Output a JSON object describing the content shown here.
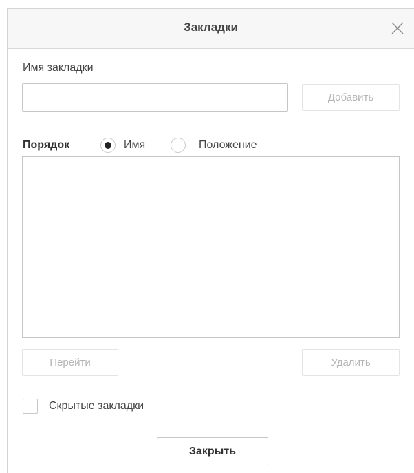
{
  "dialog": {
    "title": "Закладки",
    "close_icon": "close-icon",
    "name_label": "Имя закладки",
    "name_input": {
      "value": "",
      "placeholder": ""
    },
    "add_button": "Добавить",
    "sort": {
      "label": "Порядок",
      "options": [
        {
          "label": "Имя",
          "selected": true
        },
        {
          "label": "Положение",
          "selected": false
        }
      ]
    },
    "bookmarks": [],
    "go_button": "Перейти",
    "delete_button": "Удалить",
    "hidden_checkbox": {
      "label": "Скрытые закладки",
      "checked": false
    },
    "close_button": "Закрыть"
  },
  "colors": {
    "header_bg": "#f7f7f7",
    "border": "#c6c6c6",
    "disabled_text": "#b5b5b5",
    "text": "#333333"
  }
}
